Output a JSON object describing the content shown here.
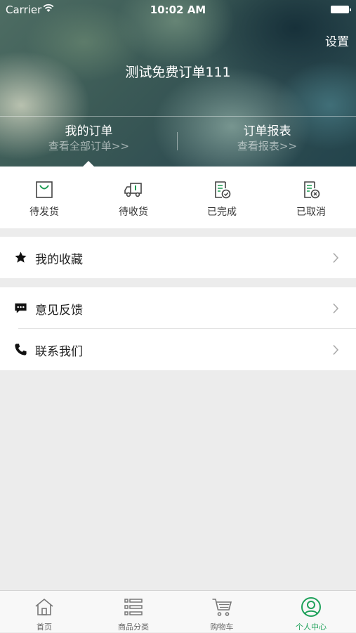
{
  "status_bar": {
    "carrier": "Carrier",
    "time": "10:02 AM"
  },
  "header": {
    "settings": "设置",
    "title": "测试免费订单111",
    "tabs": [
      {
        "title": "我的订单",
        "subtitle": "查看全部订单>>"
      },
      {
        "title": "订单报表",
        "subtitle": "查看报表>>"
      }
    ]
  },
  "order_status": [
    {
      "label": "待发货",
      "icon": "shopping-bag-icon"
    },
    {
      "label": "待收货",
      "icon": "delivery-truck-icon"
    },
    {
      "label": "已完成",
      "icon": "order-complete-icon"
    },
    {
      "label": "已取消",
      "icon": "order-cancel-icon"
    }
  ],
  "menu": {
    "favorites": {
      "label": "我的收藏",
      "icon": "star-icon"
    },
    "feedback": {
      "label": "意见反馈",
      "icon": "chat-bubble-icon"
    },
    "contact": {
      "label": "联系我们",
      "icon": "phone-icon"
    }
  },
  "tab_bar": [
    {
      "label": "首页",
      "icon": "home-icon"
    },
    {
      "label": "商品分类",
      "icon": "category-list-icon"
    },
    {
      "label": "购物车",
      "icon": "shopping-cart-icon"
    },
    {
      "label": "个人中心",
      "icon": "user-profile-icon",
      "active": true
    }
  ],
  "colors": {
    "accent": "#1ea15a",
    "icon_green": "#1a9a50",
    "background": "#ececec"
  }
}
